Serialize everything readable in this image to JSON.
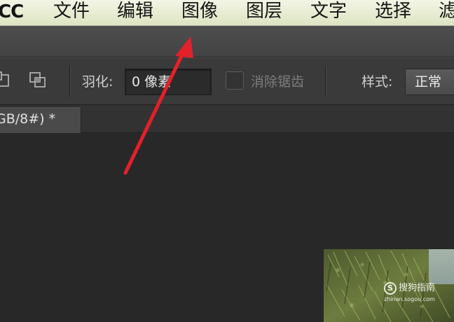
{
  "menubar": {
    "app_name": "CC",
    "items": [
      {
        "label": "文件"
      },
      {
        "label": "编辑"
      },
      {
        "label": "图像"
      },
      {
        "label": "图层"
      },
      {
        "label": "文字"
      },
      {
        "label": "选择"
      },
      {
        "label": "滤"
      }
    ]
  },
  "options_bar": {
    "feather_label": "羽化:",
    "feather_value": "0 像素",
    "antialias_label": "消除锯齿",
    "antialias_checked": false,
    "style_label": "样式:",
    "style_value": "正常"
  },
  "document": {
    "tab_title": "GB/8#) *"
  },
  "watermark": {
    "brand": "搜狗指南",
    "url": "zhinan.sogou.com"
  },
  "annotation": {
    "arrow_color": "#e4202a",
    "points_to": "图像"
  }
}
